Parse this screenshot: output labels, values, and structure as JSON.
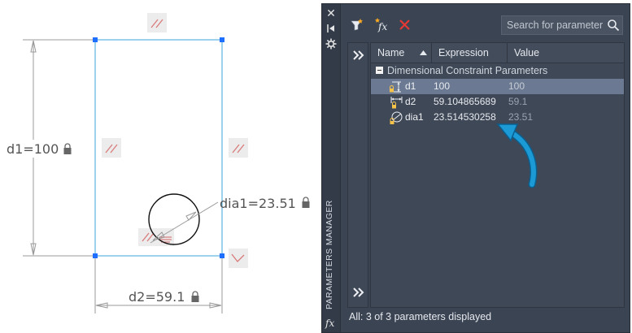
{
  "drawing": {
    "dim_d1": "d1=100",
    "dim_d2": "d2=59.1",
    "dim_dia1": "dia1=23.51"
  },
  "palette": {
    "title": "PARAMETERS MANAGER",
    "strip_buttons": [
      "close-icon",
      "pin-icon",
      "settings-icon"
    ],
    "search": {
      "placeholder": "Search for parameter"
    },
    "columns": [
      "Name",
      "Expression",
      "Value"
    ],
    "sort_column": "Name",
    "group": {
      "label": "Dimensional Constraint Parameters"
    },
    "parameters": [
      {
        "name": "d1",
        "expression": "100",
        "value": "100",
        "icon": "linear-vertical-dimension-icon",
        "selected": true
      },
      {
        "name": "d2",
        "expression": "59.104865689",
        "value": "59.1",
        "icon": "linear-horizontal-dimension-icon",
        "selected": false
      },
      {
        "name": "dia1",
        "expression": "23.514530258",
        "value": "23.51",
        "icon": "diameter-dimension-icon",
        "selected": false
      }
    ],
    "status": "All: 3 of 3 parameters displayed",
    "colors": {
      "panel": "#3b4453",
      "selection": "#6b7a92",
      "delete": "#e53935",
      "arrow": "#1b9ad6"
    }
  }
}
